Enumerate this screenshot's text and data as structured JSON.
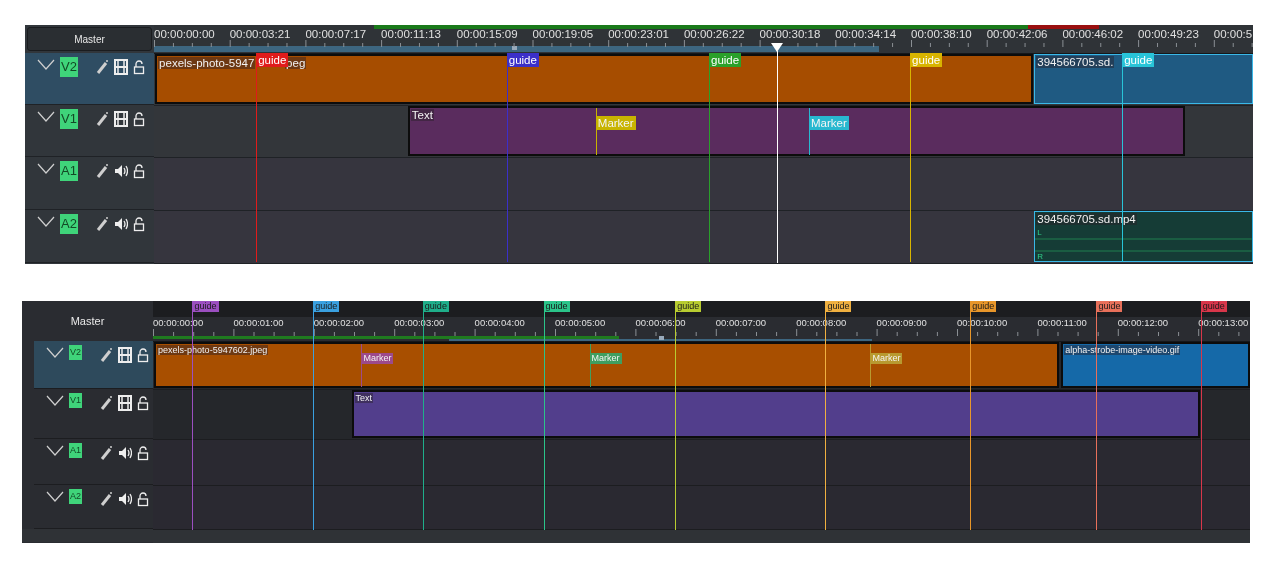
{
  "panels": [
    {
      "master": "Master",
      "playhead": true,
      "ruler": [
        "00:00:00:00",
        "00:00:03:21",
        "00:00:07:17",
        "00:00:11:13",
        "00:00:15:09",
        "00:00:19:05",
        "00:00:23:01",
        "00:00:26:22",
        "00:00:30:18",
        "00:00:34:14",
        "00:00:38:10",
        "00:00:42:06",
        "00:00:46:02",
        "00:00:49:23",
        "00:00:5"
      ],
      "guides": [
        {
          "label": "guide",
          "color": "#e01b1b"
        },
        {
          "label": "guide",
          "color": "#3b2fc9"
        },
        {
          "label": "guide",
          "color": "#2aa02a"
        },
        {
          "label": "guide",
          "color": "#d8b400"
        },
        {
          "label": "guide",
          "color": "#28c4d8"
        }
      ],
      "tracks": [
        {
          "name": "V2",
          "kind": "video",
          "selected": true,
          "clips": [
            {
              "kind": "image",
              "label": "pexels-photo-5947",
              "label_tail": "peg",
              "selected": false
            },
            {
              "kind": "video",
              "label": "394566705.sd.",
              "selected": true
            }
          ]
        },
        {
          "name": "V1",
          "kind": "video",
          "selected": false,
          "clips": [
            {
              "kind": "title",
              "label": "Text",
              "selected": false,
              "markers": [
                {
                  "label": "Marker",
                  "color": "#c8b400"
                },
                {
                  "label": "Marker",
                  "color": "#28b8d0"
                }
              ]
            }
          ]
        },
        {
          "name": "A1",
          "kind": "audio",
          "selected": false
        },
        {
          "name": "A2",
          "kind": "audio",
          "selected": false,
          "clips": [
            {
              "kind": "audio",
              "label": "394566705.sd.mp4",
              "selected": true,
              "channels": [
                "L",
                "R"
              ]
            }
          ]
        }
      ]
    },
    {
      "master": "Master",
      "ruler": [
        "00:00:00:00",
        "00:00:01:00",
        "00:00:02:00",
        "00:00:03:00",
        "00:00:04:00",
        "00:00:05:00",
        "00:00:06:00",
        "00:00:07:00",
        "00:00:08:00",
        "00:00:09:00",
        "00:00:10:00",
        "00:00:11:00",
        "00:00:12:00",
        "00:00:13:00"
      ],
      "guides": [
        {
          "label": "guide",
          "color": "#9b4fc0"
        },
        {
          "label": "guide",
          "color": "#3aa0e0"
        },
        {
          "label": "guide",
          "color": "#1fae8a"
        },
        {
          "label": "guide",
          "color": "#2bc48a"
        },
        {
          "label": "guide",
          "color": "#b8cc30"
        },
        {
          "label": "guide",
          "color": "#f0b040"
        },
        {
          "label": "guide",
          "color": "#e8962a"
        },
        {
          "label": "guide",
          "color": "#e8705a"
        },
        {
          "label": "guide",
          "color": "#d8364a"
        }
      ],
      "tracks": [
        {
          "name": "V2",
          "kind": "video",
          "selected": true,
          "clips": [
            {
              "kind": "image",
              "label": "pexels-photo-5947602.jpeg",
              "selected": false,
              "markers": [
                {
                  "label": "Marker",
                  "color": "#9c4a8c"
                },
                {
                  "label": "Marker",
                  "color": "#3f9e60"
                },
                {
                  "label": "Marker",
                  "color": "#b89a30"
                }
              ]
            },
            {
              "kind": "video",
              "label": "alpha-strobe-image-video.gif",
              "selected": false
            }
          ]
        },
        {
          "name": "V1",
          "kind": "video",
          "selected": false,
          "clips": [
            {
              "kind": "title",
              "label": "Text",
              "selected": false
            }
          ]
        },
        {
          "name": "A1",
          "kind": "audio",
          "selected": false
        },
        {
          "name": "A2",
          "kind": "audio",
          "selected": false
        }
      ]
    }
  ]
}
